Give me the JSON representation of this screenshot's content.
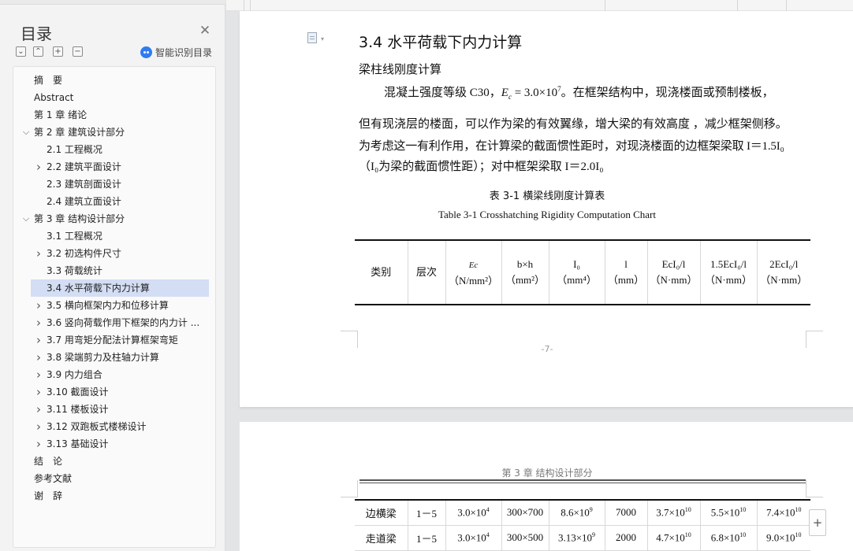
{
  "sidebar": {
    "title": "目录",
    "ai_label": "智能识别目录",
    "items": [
      {
        "label": "摘　要",
        "level": 1,
        "chevron": "none"
      },
      {
        "label": "Abstract",
        "level": 1,
        "chevron": "none"
      },
      {
        "label": "第 1 章  绪论",
        "level": 1,
        "chevron": "none"
      },
      {
        "label": "第 2 章  建筑设计部分",
        "level": 1,
        "chevron": "expanded"
      },
      {
        "label": "2.1 工程概况",
        "level": 2,
        "chevron": "none"
      },
      {
        "label": "2.2 建筑平面设计",
        "level": 2,
        "chevron": "collapsed"
      },
      {
        "label": "2.3 建筑剖面设计",
        "level": 2,
        "chevron": "none"
      },
      {
        "label": "2.4 建筑立面设计",
        "level": 2,
        "chevron": "none"
      },
      {
        "label": "第 3 章  结构设计部分",
        "level": 1,
        "chevron": "expanded"
      },
      {
        "label": "3.1 工程概况",
        "level": 2,
        "chevron": "none"
      },
      {
        "label": "3.2  初选构件尺寸",
        "level": 2,
        "chevron": "collapsed"
      },
      {
        "label": "3.3 荷载统计",
        "level": 2,
        "chevron": "none"
      },
      {
        "label": "3.4  水平荷载下内力计算",
        "level": 2,
        "chevron": "none",
        "active": true
      },
      {
        "label": "3.5 横向框架内力和位移计算",
        "level": 2,
        "chevron": "collapsed"
      },
      {
        "label": "3.6 竖向荷载作用下框架的内力计 ...",
        "level": 2,
        "chevron": "collapsed"
      },
      {
        "label": "3.7 用弯矩分配法计算框架弯矩",
        "level": 2,
        "chevron": "collapsed"
      },
      {
        "label": "3.8  梁端剪力及柱轴力计算",
        "level": 2,
        "chevron": "collapsed"
      },
      {
        "label": "3.9  内力组合",
        "level": 2,
        "chevron": "collapsed"
      },
      {
        "label": "3.10 截面设计",
        "level": 2,
        "chevron": "collapsed"
      },
      {
        "label": "3.11 楼板设计",
        "level": 2,
        "chevron": "collapsed"
      },
      {
        "label": "3.12 双跑板式楼梯设计",
        "level": 2,
        "chevron": "collapsed"
      },
      {
        "label": "3.13 基础设计",
        "level": 2,
        "chevron": "collapsed"
      },
      {
        "label": "结　论",
        "level": 1,
        "chevron": "none"
      },
      {
        "label": "参考文献",
        "level": 1,
        "chevron": "none"
      },
      {
        "label": "谢　辞",
        "level": 1,
        "chevron": "none"
      }
    ]
  },
  "icons": {
    "close": "close-icon",
    "collapse": "collapse-all-icon",
    "expand": "expand-all-icon",
    "add": "add-heading-icon",
    "remove": "remove-heading-icon",
    "ai": "ai-recognize-icon"
  },
  "page1": {
    "section_heading": "3.4  水平荷载下内力计算",
    "sub_heading": "梁柱线刚度计算",
    "para1_before": "混凝土强度等级 C30，",
    "para1_math_var": "E",
    "para1_math_sub": "c",
    "para1_math_eq": " = 3.0×10",
    "para1_math_exp": "7",
    "para1_after": "。在框架结构中，现浇楼面或预制楼板，",
    "para2": "但有现浇层的楼面，可以作为梁的有效翼缘，增大梁的有效高度 ，减少框架侧移。",
    "para3": "为考虑这一有利作用，在计算梁的截面惯性距时，对现浇楼面的边框架梁取 I＝1.5I₀",
    "para4": "（I₀为梁的截面惯性距）；对中框架梁取 I＝2.0I₀",
    "table_title_cn": "表 3-1 横梁线刚度计算表",
    "table_title_en": "Table 3-1 Crosshatching Rigidity Computation Chart",
    "page_number": "-7-"
  },
  "table_header": {
    "c1": "类别",
    "c2": "层次",
    "c3_top": "Ec",
    "c3_bottom": "（N/mm²）",
    "c4_top": "b×h",
    "c4_bottom": "（mm²）",
    "c5_top": "I₀",
    "c5_bottom": "（mm⁴）",
    "c6_top": "l",
    "c6_bottom": "（mm）",
    "c7_top": "EcI₀/l",
    "c7_bottom": "（N·mm）",
    "c8_top": "1.5EcI₀/l",
    "c8_bottom": "（N·mm）",
    "c9_top": "2EcI₀/l",
    "c9_bottom": "（N·mm）"
  },
  "page2": {
    "running_head": "第 3 章  结构设计部分",
    "rows": [
      {
        "name": "边横梁",
        "floor": "1－5",
        "ec": "3.0×10",
        "ec_exp": "4",
        "bh": "300×700",
        "i0": "8.6×10",
        "i0_exp": "9",
        "l": "7000",
        "r1": "3.7×10",
        "r1_exp": "10",
        "r2": "5.5×10",
        "r2_exp": "10",
        "r3": "7.4×10",
        "r3_exp": "10"
      },
      {
        "name": "走道梁",
        "floor": "1－5",
        "ec": "3.0×10",
        "ec_exp": "4",
        "bh": "300×500",
        "i0": "3.13×10",
        "i0_exp": "9",
        "l": "2000",
        "r1": "4.7×10",
        "r1_exp": "10",
        "r2": "6.8×10",
        "r2_exp": "10",
        "r3": "9.0×10",
        "r3_exp": "10"
      }
    ]
  },
  "zoom": {
    "plus_label": "+"
  }
}
